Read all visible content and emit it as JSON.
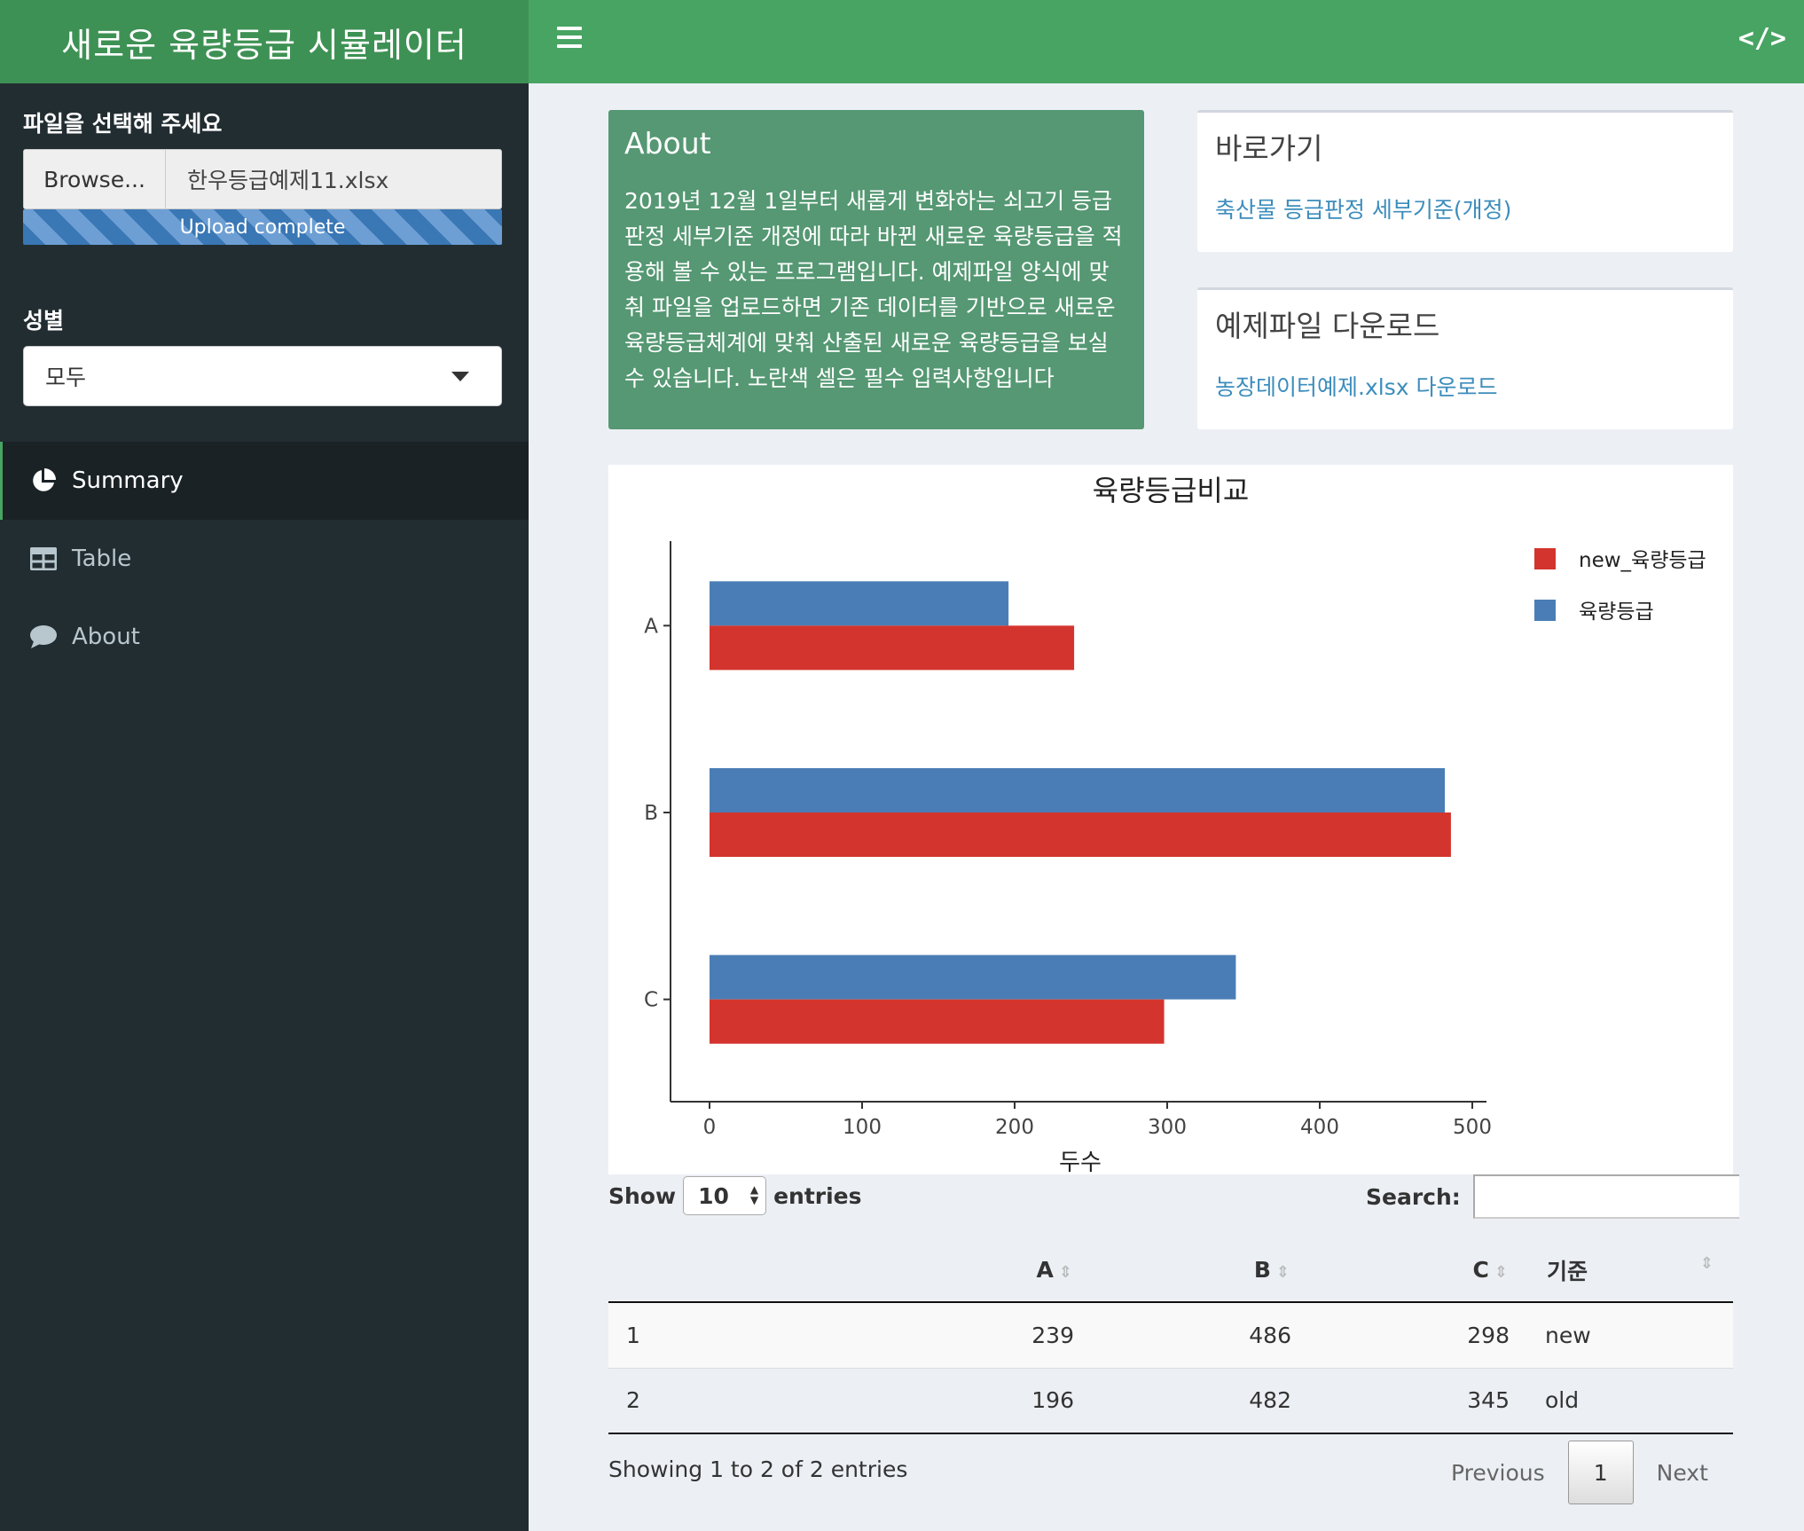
{
  "app": {
    "title": "새로운 육량등급 시뮬레이터"
  },
  "sidebar": {
    "file_label": "파일을 선택해 주세요",
    "browse_label": "Browse...",
    "file_name": "한우등급예제11.xlsx",
    "upload_status": "Upload complete",
    "upload_progress": 1.0,
    "sex_label": "성별",
    "sex_value": "모두",
    "items": [
      {
        "label": "Summary",
        "icon": "pie-chart-icon",
        "active": true
      },
      {
        "label": "Table",
        "icon": "table-icon",
        "active": false
      },
      {
        "label": "About",
        "icon": "comment-icon",
        "active": false
      }
    ]
  },
  "about_box": {
    "title": "About",
    "text": "2019년 12월 1일부터 새롭게 변화하는 쇠고기 등급판정 세부기준 개정에 따라 바뀐 새로운 육량등급을 적용해 볼 수 있는 프로그램입니다. 예제파일 양식에 맞춰 파일을 업로드하면 기존 데이터를 기반으로 새로운 육량등급체계에 맞춰 산출된 새로운 육량등급을 보실 수 있습니다. 노란색 셀은 필수 입력사항입니다"
  },
  "shortcut_box": {
    "title": "바로가기",
    "link": "축산물 등급판정 세부기준(개정)"
  },
  "download_box": {
    "title": "예제파일 다운로드",
    "link": "농장데이터예제.xlsx 다운로드"
  },
  "chart_data": {
    "type": "bar",
    "orientation": "horizontal",
    "title": "육량등급비교",
    "xlabel": "두수",
    "ylabel": "",
    "categories": [
      "A",
      "B",
      "C"
    ],
    "series": [
      {
        "name": "new_육량등급",
        "values": [
          239,
          486,
          298
        ],
        "color": "#d3352e"
      },
      {
        "name": "육량등급",
        "values": [
          196,
          482,
          345
        ],
        "color": "#4a7db5"
      }
    ],
    "xlim": [
      0,
      510
    ],
    "xticks": [
      0,
      100,
      200,
      300,
      400,
      500
    ],
    "legend_position": "top-right",
    "grid": false
  },
  "table": {
    "show_label": "Show",
    "entries_label": "entries",
    "page_length": "10",
    "search_label": "Search:",
    "search_value": "",
    "columns": [
      "",
      "A",
      "B",
      "C",
      "기준"
    ],
    "rows": [
      [
        "1",
        "239",
        "486",
        "298",
        "new"
      ],
      [
        "2",
        "196",
        "482",
        "345",
        "old"
      ]
    ],
    "info": "Showing 1 to 2 of 2 entries",
    "prev_label": "Previous",
    "page": "1",
    "next_label": "Next"
  },
  "colors": {
    "header_logo": "#3e9154",
    "header_bar": "#48a463",
    "sidebar": "#222d32",
    "about_box": "#559873",
    "link": "#3c8dbc"
  }
}
